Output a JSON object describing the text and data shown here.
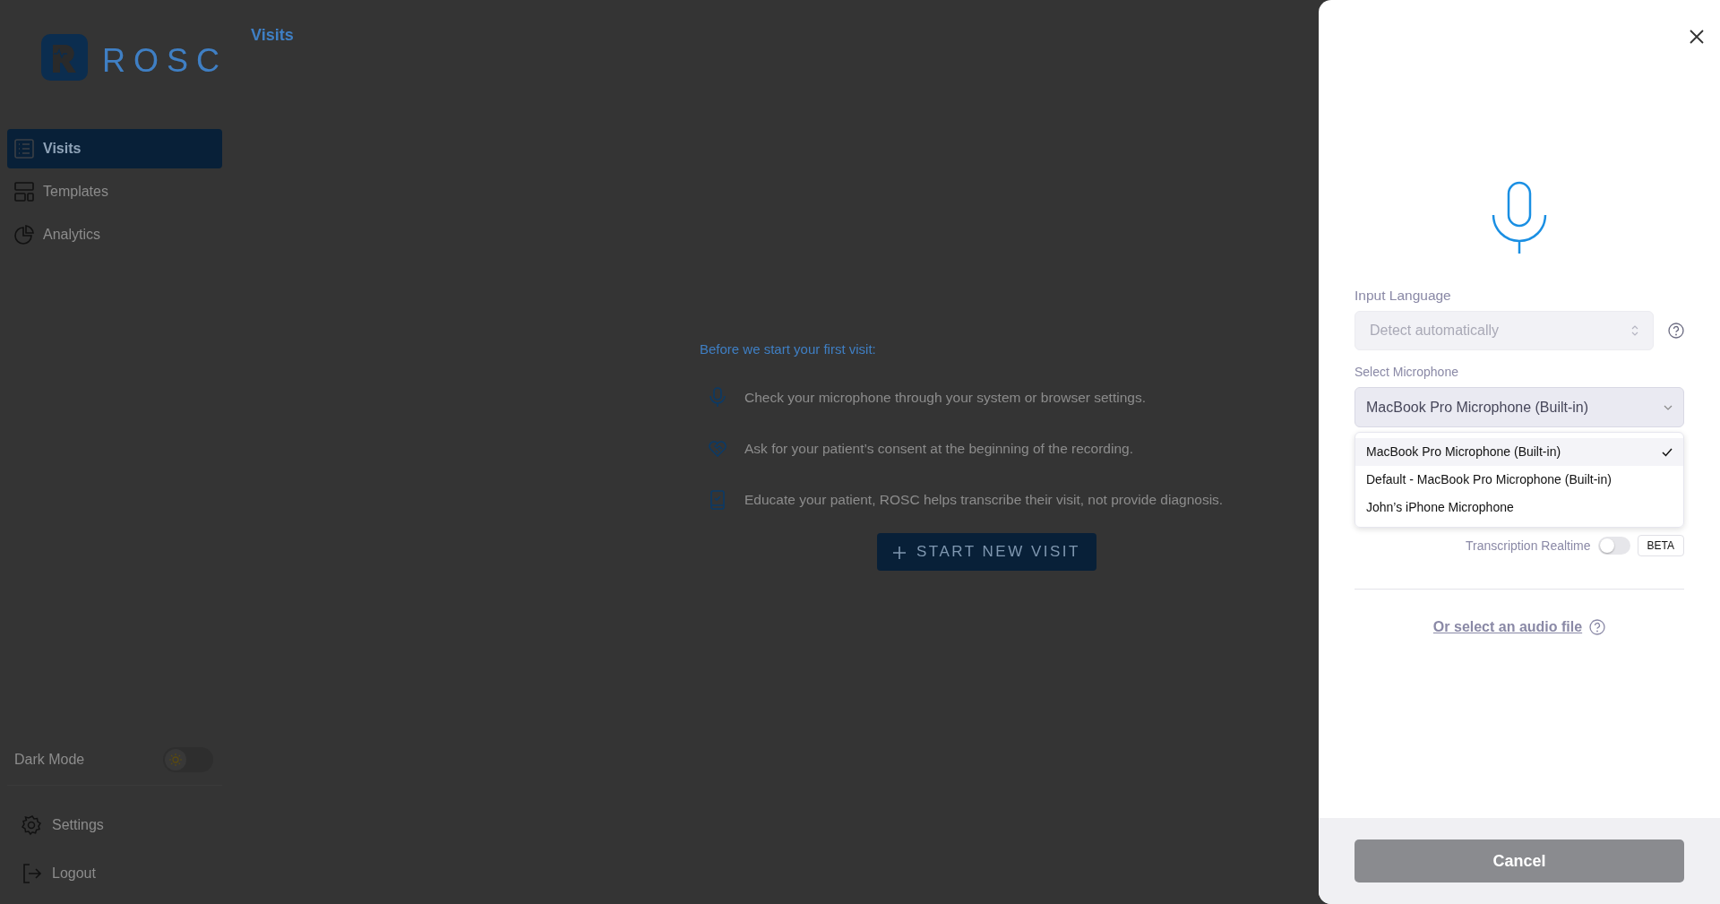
{
  "sidebar": {
    "logo_text": "ROSC",
    "items": [
      {
        "label": "Visits",
        "selected": true
      },
      {
        "label": "Templates",
        "selected": false
      },
      {
        "label": "Analytics",
        "selected": false
      }
    ],
    "dark_mode": {
      "label": "Dark Mode",
      "on": false
    },
    "bottom_items": [
      {
        "label": "Settings"
      },
      {
        "label": "Logout"
      }
    ]
  },
  "page": {
    "title": "Visits",
    "intro": "Before we start your first visit:",
    "tips": [
      "Check your microphone through your system or browser settings.",
      "Ask for your patient’s consent at the beginning of the recording.",
      "Educate your patient, ROSC helps transcribe their visit, not provide diagnosis."
    ],
    "start_button": "START NEW VISIT"
  },
  "panel": {
    "input_language": {
      "label": "Input Language",
      "value": "Detect automatically",
      "disabled": true
    },
    "microphone": {
      "label": "Select Microphone",
      "value": "MacBook Pro Microphone (Built-in)",
      "expanded": true,
      "options": [
        {
          "label": "MacBook Pro Microphone (Built-in)",
          "selected": true
        },
        {
          "label": "Default - MacBook Pro Microphone (Built-in)",
          "selected": false
        },
        {
          "label": "John’s iPhone Microphone",
          "selected": false
        }
      ]
    },
    "realtime": {
      "label": "Transcription Realtime",
      "on": false,
      "badge": "BETA"
    },
    "audio_link": "Or select an audio file",
    "cancel": "Cancel"
  }
}
